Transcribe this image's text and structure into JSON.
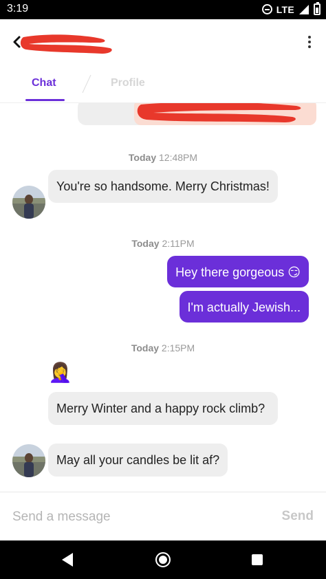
{
  "status_bar": {
    "time": "3:19",
    "network": "LTE",
    "icons": [
      "do-not-disturb-icon",
      "signal-icon",
      "battery-icon"
    ]
  },
  "header": {
    "contact_name": "",
    "back_icon": "chevron-left-icon",
    "menu_icon": "more-vertical-icon"
  },
  "tabs": [
    {
      "label": "Chat",
      "active": true
    },
    {
      "label": "Profile",
      "active": false
    }
  ],
  "colors": {
    "accent": "#6b2fd9",
    "incoming_bubble": "#eeeeee",
    "redaction": "#e8382b"
  },
  "conversation": {
    "timestamps": [
      {
        "day": "Today",
        "time": "12:48PM"
      },
      {
        "day": "Today",
        "time": "2:11PM"
      },
      {
        "day": "Today",
        "time": "2:15PM"
      }
    ],
    "messages": [
      {
        "direction": "incoming",
        "text": "You're so handsome. Merry Christmas!"
      },
      {
        "direction": "outgoing",
        "text": "Hey there gorgeous 😏"
      },
      {
        "direction": "outgoing",
        "text": "I'm actually Jewish..."
      },
      {
        "direction": "incoming",
        "text": "🤦‍♀️"
      },
      {
        "direction": "incoming",
        "text": "Merry Winter and a happy rock climb?"
      },
      {
        "direction": "incoming",
        "text": "May all your candles be lit af?"
      }
    ]
  },
  "composer": {
    "placeholder": "Send a message",
    "send_label": "Send"
  },
  "nav_bar": {
    "icons": [
      "back-triangle-icon",
      "home-circle-icon",
      "recents-square-icon"
    ]
  }
}
